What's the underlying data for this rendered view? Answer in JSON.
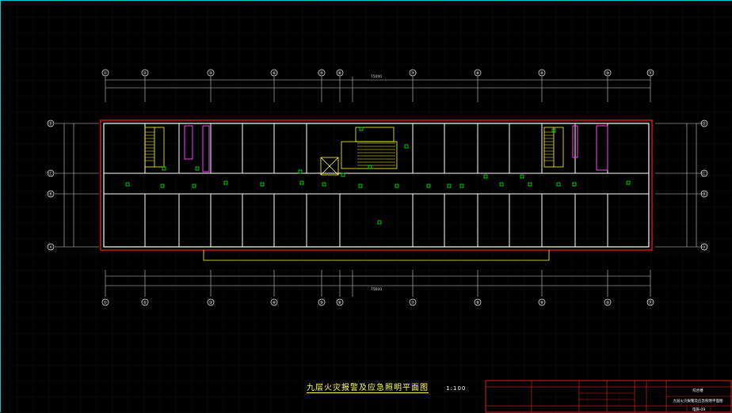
{
  "drawing": {
    "title": "九层火灾报警及应急照明平面图",
    "scale": "1:100"
  },
  "axes": {
    "columns": [
      "①",
      "②",
      "③",
      "④",
      "⑤",
      "⑥",
      "⑦",
      "⑧",
      "⑨",
      "⑩",
      "⑪"
    ],
    "rows": [
      "Ⓐ",
      "Ⓑ",
      "Ⓒ",
      "Ⓓ"
    ],
    "overall_dim": "75000"
  },
  "title_block": {
    "project": "综合楼",
    "drawing_name": "九层火灾报警及应急照明平面图",
    "drawing_no": "电施-09"
  },
  "colors": {
    "walls": "#ffffff",
    "dims": "#cfcfcf",
    "boundary": "#ff2020",
    "stairs": "#ffff40",
    "toilets": "#ff40ff",
    "devices": "#00ff00",
    "frame": "#ff3030"
  }
}
